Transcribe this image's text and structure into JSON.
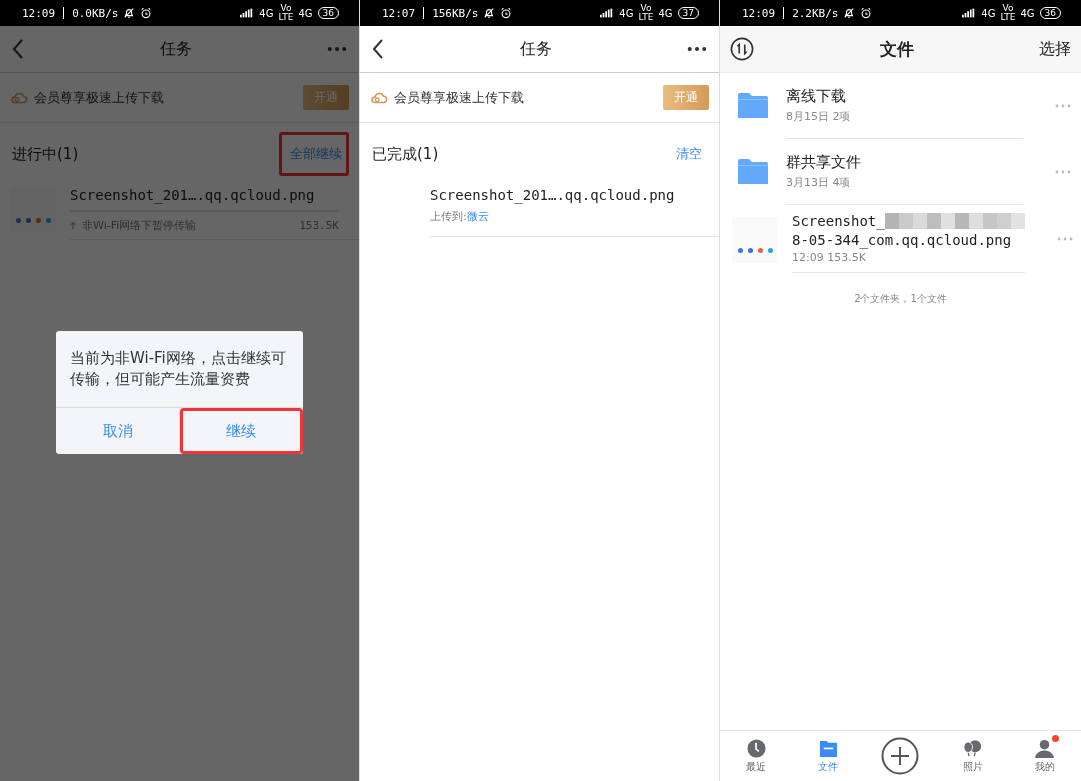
{
  "panels": [
    {
      "kind": "tasks",
      "status_bar": {
        "time": "12:09",
        "speed": "0.0KB/s",
        "network_1": "4G",
        "volte_top": "Vo",
        "volte_bottom": "LTE",
        "network_2": "4G",
        "battery": "36"
      },
      "header": {
        "title": "任务"
      },
      "banner": {
        "text": "会员尊享极速上传下载",
        "button": "开通"
      },
      "section": {
        "title": "进行中(1)",
        "action": "全部继续",
        "action_highlighted": true
      },
      "tasks": [
        {
          "kind": "paused",
          "name": "Screenshot_201….qq.qcloud.png",
          "status": "非Wi-Fi网络下暂停传输",
          "size": "153.5K"
        }
      ],
      "dialog": {
        "message": "当前为非Wi-Fi网络，点击继续可传输，但可能产生流量资费",
        "buttons": [
          {
            "label": "取消",
            "highlighted": false
          },
          {
            "label": "继续",
            "highlighted": true
          }
        ]
      }
    },
    {
      "kind": "tasks",
      "status_bar": {
        "time": "12:07",
        "speed": "156KB/s",
        "network_1": "4G",
        "volte_top": "Vo",
        "volte_bottom": "LTE",
        "network_2": "4G",
        "battery": "37"
      },
      "header": {
        "title": "任务"
      },
      "banner": {
        "text": "会员尊享极速上传下载",
        "button": "开通"
      },
      "section": {
        "title": "已完成(1)",
        "action": "清空",
        "action_highlighted": false
      },
      "tasks": [
        {
          "kind": "done",
          "name": "Screenshot_201….qq.qcloud.png",
          "status": "上传到: ",
          "link": "微云"
        }
      ]
    },
    {
      "kind": "files",
      "status_bar": {
        "time": "12:09",
        "speed": "2.2KB/s",
        "network_1": "4G",
        "volte_top": "Vo",
        "volte_bottom": "LTE",
        "network_2": "4G",
        "battery": "36"
      },
      "header": {
        "title": "文件",
        "action": "选择"
      },
      "files": [
        {
          "kind": "folder",
          "name": "离线下载",
          "meta": "8月15日 2项"
        },
        {
          "kind": "folder",
          "name": "群共享文件",
          "meta": "3月13日 4项"
        },
        {
          "kind": "image",
          "name": "Screenshot_",
          "name_line_2": "8-05-344_com.qq.qcloud.png",
          "meta": "12:09 153.5K"
        }
      ],
      "summary": "2个文件夹，1个文件",
      "nav": [
        {
          "kind": "recent",
          "label": "最近",
          "selected": false,
          "badge": false
        },
        {
          "kind": "files",
          "label": "文件",
          "selected": true,
          "badge": false
        },
        {
          "kind": "add",
          "selected": false,
          "badge": false
        },
        {
          "kind": "photos",
          "label": "照片",
          "selected": false,
          "badge": false
        },
        {
          "kind": "me",
          "label": "我的",
          "selected": false,
          "badge": true
        }
      ]
    }
  ]
}
